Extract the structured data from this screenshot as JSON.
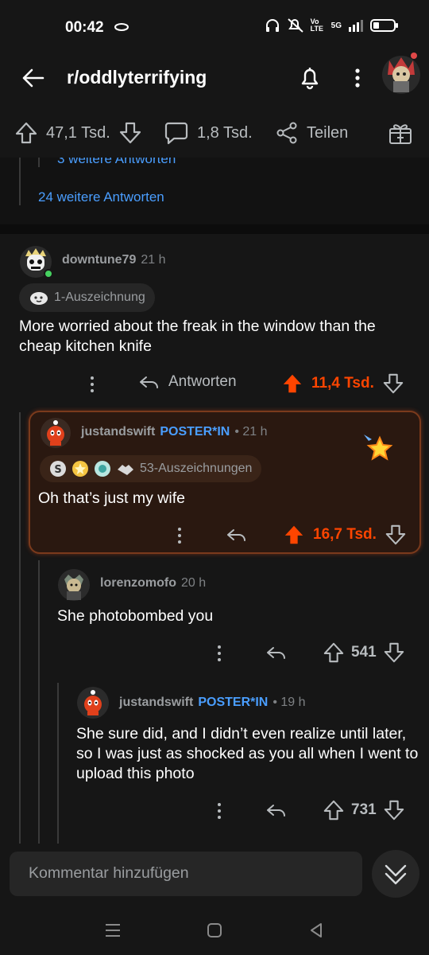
{
  "status_bar": {
    "time": "00:42",
    "network_label": "Vo LTE",
    "signal_label": "5G"
  },
  "header": {
    "title": "r/oddlyterrifying"
  },
  "post_actions": {
    "upvotes": "47,1 Tsd.",
    "comments": "1,8 Tsd.",
    "share_label": "Teilen"
  },
  "thread": {
    "prev_more_replies": "3 weitere Antworten",
    "more_replies": "24 weitere Antworten",
    "comments": [
      {
        "author": "downtune79",
        "time": "21 h",
        "award_text": "1-Auszeichnung",
        "body": "More worried about the freak in the window than the cheap kitchen knife",
        "reply_label": "Antworten",
        "score": "11,4 Tsd."
      },
      {
        "author": "justandswift",
        "op_tag": "POSTER*IN",
        "time": "• 21 h",
        "award_text": "53-Auszeichnungen",
        "body": "Oh that’s just my wife",
        "score": "16,7 Tsd."
      },
      {
        "author": "lorenzomofo",
        "time": "20 h",
        "body": "She photobombed you",
        "score": "541"
      },
      {
        "author": "justandswift",
        "op_tag": "POSTER*IN",
        "time": "• 19 h",
        "body": "She sure did, and I didn’t even realize until later, so I was just as shocked as you all when I went to upload this photo",
        "score": "731"
      }
    ]
  },
  "comment_box": {
    "placeholder": "Kommentar hinzufügen"
  },
  "colors": {
    "background": "#161616",
    "accent_upvote": "#ff4500",
    "link_blue": "#4a9eff",
    "highlight_border": "#7a3a1c"
  }
}
